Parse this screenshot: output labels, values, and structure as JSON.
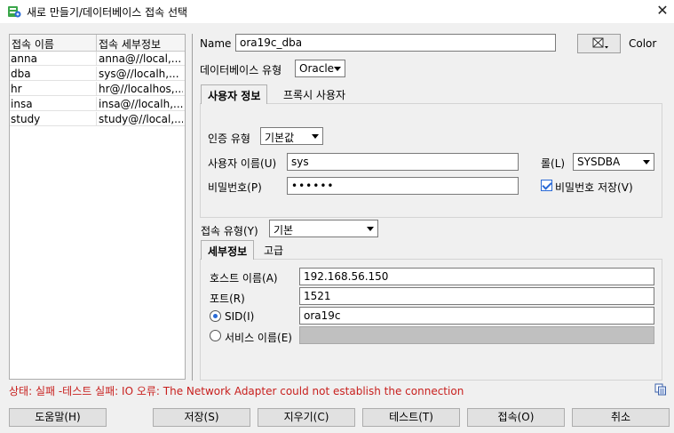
{
  "window": {
    "title": "새로 만들기/데이터베이스 접속 선택",
    "close_glyph": "✕"
  },
  "connections": {
    "headers": [
      "접속 이름",
      "접속 세부정보"
    ],
    "rows": [
      [
        "anna",
        "anna@//local,..."
      ],
      [
        "dba",
        "sys@//localh,..."
      ],
      [
        "hr",
        "hr@//localhos,..."
      ],
      [
        "insa",
        "insa@//localh,..."
      ],
      [
        "study",
        "study@//local,..."
      ]
    ]
  },
  "form": {
    "name_label": "Name",
    "name_value": "ora19c_dba",
    "color_label": "Color",
    "db_type_label": "데이터베이스 유형",
    "db_type_value": "Oracle",
    "tabs_user": [
      "사용자 정보",
      "프록시 사용자"
    ],
    "auth_type_label": "인증 유형",
    "auth_type_value": "기본값",
    "username_label": "사용자 이름(U)",
    "username_value": "sys",
    "role_label": "롤(L)",
    "role_value": "SYSDBA",
    "password_label": "비밀번호(P)",
    "password_value": "••••••",
    "save_password_label": "비밀번호 저장(V)",
    "conn_type_label": "접속 유형(Y)",
    "conn_type_value": "기본",
    "tabs_detail": [
      "세부정보",
      "고급"
    ],
    "host_label": "호스트 이름(A)",
    "host_value": "192.168.56.150",
    "port_label": "포트(R)",
    "port_value": "1521",
    "sid_label": "SID(I)",
    "sid_value": "ora19c",
    "service_label": "서비스 이름(E)",
    "service_value": ""
  },
  "status": "상태: 실패 -테스트 실패: IO 오류: The Network Adapter could not establish the connection",
  "buttons": {
    "help": "도움말(H)",
    "save": "저장(S)",
    "clear": "지우기(C)",
    "test": "테스트(T)",
    "connect": "접속(O)",
    "cancel": "취소"
  },
  "colors": {
    "status_error": "#c8201e",
    "accent": "#2a6ad6"
  }
}
